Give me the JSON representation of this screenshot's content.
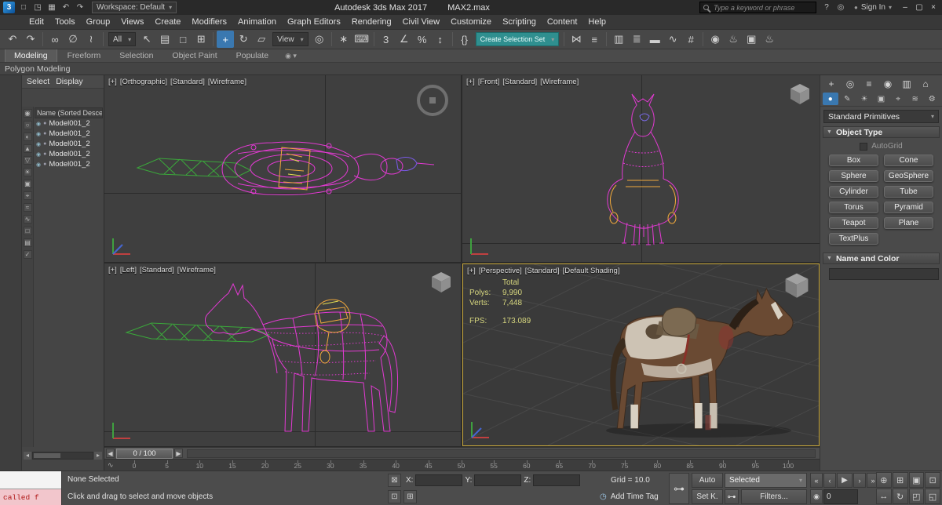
{
  "titlebar": {
    "logo_text": "3",
    "quick_icons": [
      {
        "name": "new-scene-icon",
        "glyph": "□"
      },
      {
        "name": "open-file-icon",
        "glyph": "◳"
      },
      {
        "name": "save-file-icon",
        "glyph": "▦"
      },
      {
        "name": "undo-quick-icon",
        "glyph": "↶"
      },
      {
        "name": "redo-quick-icon",
        "glyph": "↷"
      }
    ],
    "workspace_label": "Workspace: Default",
    "app_title": "Autodesk 3ds Max 2017",
    "file_name": "MAX2.max",
    "search_placeholder": "Type a keyword or phrase",
    "right_icons": [
      {
        "name": "help-icon",
        "glyph": "?"
      },
      {
        "name": "notifications-icon",
        "glyph": "◎"
      }
    ],
    "sign_in_label": "Sign In",
    "window_icons": [
      {
        "name": "minimize-icon",
        "glyph": "–"
      },
      {
        "name": "maximize-icon",
        "glyph": "▢"
      },
      {
        "name": "close-icon",
        "glyph": "×"
      }
    ]
  },
  "menubar": {
    "items": [
      "Edit",
      "Tools",
      "Group",
      "Views",
      "Create",
      "Modifiers",
      "Animation",
      "Graph Editors",
      "Rendering",
      "Civil View",
      "Customize",
      "Scripting",
      "Content",
      "Help"
    ]
  },
  "toolbar": {
    "items": [
      {
        "t": "icon",
        "name": "undo-icon",
        "glyph": "↶"
      },
      {
        "t": "icon",
        "name": "redo-icon",
        "glyph": "↷"
      },
      {
        "t": "sep"
      },
      {
        "t": "icon",
        "name": "select-and-link-icon",
        "glyph": "∞"
      },
      {
        "t": "icon",
        "name": "unlink-selection-icon",
        "glyph": "∅"
      },
      {
        "t": "icon",
        "name": "bind-to-spacewarp-icon",
        "glyph": "≀"
      },
      {
        "t": "sep"
      },
      {
        "t": "dd",
        "name": "selection-filter-dropdown",
        "label": "All"
      },
      {
        "t": "icon",
        "name": "select-object-icon",
        "glyph": "↖"
      },
      {
        "t": "icon",
        "name": "select-by-name-icon",
        "glyph": "▤"
      },
      {
        "t": "icon",
        "name": "selection-region-icon",
        "glyph": "□"
      },
      {
        "t": "icon",
        "name": "window-crossing-icon",
        "glyph": "⊞"
      },
      {
        "t": "sep"
      },
      {
        "t": "icon",
        "name": "select-and-move-icon",
        "glyph": "+",
        "active": true
      },
      {
        "t": "icon",
        "name": "select-and-rotate-icon",
        "glyph": "↻"
      },
      {
        "t": "icon",
        "name": "select-and-scale-icon",
        "glyph": "▱"
      },
      {
        "t": "dd",
        "name": "reference-coordinate-dropdown",
        "label": "View"
      },
      {
        "t": "icon",
        "name": "use-pivot-point-icon",
        "glyph": "◎"
      },
      {
        "t": "sep"
      },
      {
        "t": "icon",
        "name": "select-and-manipulate-icon",
        "glyph": "∗"
      },
      {
        "t": "icon",
        "name": "keyboard-override-icon",
        "glyph": "⌨"
      },
      {
        "t": "sep"
      },
      {
        "t": "icon",
        "name": "snaps-toggle-icon",
        "glyph": "3"
      },
      {
        "t": "icon",
        "name": "angle-snap-icon",
        "glyph": "∠"
      },
      {
        "t": "icon",
        "name": "percent-snap-icon",
        "glyph": "%"
      },
      {
        "t": "icon",
        "name": "spinner-snap-icon",
        "glyph": "↕"
      },
      {
        "t": "sep"
      },
      {
        "t": "icon",
        "name": "edit-named-sets-icon",
        "glyph": "{}"
      },
      {
        "t": "teal",
        "name": "create-selection-set-dropdown",
        "label": "Create Selection Set"
      },
      {
        "t": "sep"
      },
      {
        "t": "icon",
        "name": "mirror-icon",
        "glyph": "⋈"
      },
      {
        "t": "icon",
        "name": "align-icon",
        "glyph": "≡"
      },
      {
        "t": "sep"
      },
      {
        "t": "icon",
        "name": "toggle-scene-explorer-icon",
        "glyph": "▥"
      },
      {
        "t": "icon",
        "name": "toggle-layer-explorer-icon",
        "glyph": "≣"
      },
      {
        "t": "icon",
        "name": "toggle-ribbon-icon",
        "glyph": "▬"
      },
      {
        "t": "icon",
        "name": "curve-editor-icon",
        "glyph": "∿"
      },
      {
        "t": "icon",
        "name": "schematic-view-icon",
        "glyph": "#"
      },
      {
        "t": "sep"
      },
      {
        "t": "icon",
        "name": "material-editor-icon",
        "glyph": "◉"
      },
      {
        "t": "icon",
        "name": "render-setup-icon",
        "glyph": "♨"
      },
      {
        "t": "icon",
        "name": "rendered-frame-window-icon",
        "glyph": "▣"
      },
      {
        "t": "icon",
        "name": "render-production-icon",
        "glyph": "♨"
      }
    ]
  },
  "ribbon": {
    "tabs": [
      "Modeling",
      "Freeform",
      "Selection",
      "Object Paint",
      "Populate"
    ],
    "active_tab": "Modeling",
    "panel_label": "Polygon Modeling"
  },
  "scene_explorer": {
    "menus": [
      "Select",
      "Display"
    ],
    "column_header": "Name (Sorted Descend",
    "row_icons": [
      {
        "name": "visibility-icon",
        "glyph": "◉"
      },
      {
        "name": "node-type-icon",
        "glyph": "●"
      }
    ],
    "tool_icons": [
      {
        "name": "se-display-all-icon",
        "glyph": "◉"
      },
      {
        "name": "se-display-none-icon",
        "glyph": "○"
      },
      {
        "name": "se-display-inverted-icon",
        "glyph": "◐"
      },
      {
        "name": "se-display-geometry-icon",
        "glyph": "▲"
      },
      {
        "name": "se-display-shapes-icon",
        "glyph": "▽"
      },
      {
        "name": "se-display-lights-icon",
        "glyph": "☀"
      },
      {
        "name": "se-display-cameras-icon",
        "glyph": "▣"
      },
      {
        "name": "se-display-helpers-icon",
        "glyph": "⌖"
      },
      {
        "name": "se-display-spacewarps-icon",
        "glyph": "≈"
      },
      {
        "name": "se-display-bones-icon",
        "glyph": "∿"
      },
      {
        "name": "se-display-containers-icon",
        "glyph": "□"
      },
      {
        "name": "se-display-materials-icon",
        "glyph": "▤"
      },
      {
        "name": "se-pick-icon",
        "glyph": "✓"
      }
    ],
    "rows": [
      "Model001_2",
      "Model001_2",
      "Model001_2",
      "Model001_2",
      "Model001_2"
    ]
  },
  "viewports": {
    "ortho": {
      "plus": "[+]",
      "name": "[Orthographic]",
      "style": "[Standard]",
      "shading": "[Wireframe]"
    },
    "front": {
      "plus": "[+]",
      "name": "[Front]",
      "style": "[Standard]",
      "shading": "[Wireframe]"
    },
    "left": {
      "plus": "[+]",
      "name": "[Left]",
      "style": "[Standard]",
      "shading": "[Wireframe]"
    },
    "persp": {
      "plus": "[+]",
      "name": "[Perspective]",
      "style": "[Standard]",
      "shading": "[Default Shading]",
      "stats": {
        "total_label": "Total",
        "polys_label": "Polys:",
        "polys_value": "9,990",
        "verts_label": "Verts:",
        "verts_value": "7,448",
        "fps_label": "FPS:",
        "fps_value": "173.089"
      }
    }
  },
  "command_panel": {
    "tabs": [
      {
        "name": "create-tab-icon",
        "glyph": "+"
      },
      {
        "name": "modify-tab-icon",
        "glyph": "◎"
      },
      {
        "name": "hierarchy-tab-icon",
        "glyph": "≡"
      },
      {
        "name": "motion-tab-icon",
        "glyph": "◉"
      },
      {
        "name": "display-tab-icon",
        "glyph": "▥"
      },
      {
        "name": "utilities-tab-icon",
        "glyph": "⌂"
      }
    ],
    "subtabs": [
      {
        "name": "geometry-icon",
        "glyph": "●",
        "active": true
      },
      {
        "name": "shapes-icon",
        "glyph": "✎"
      },
      {
        "name": "lights-icon",
        "glyph": "☀"
      },
      {
        "name": "cameras-icon",
        "glyph": "▣"
      },
      {
        "name": "helpers-icon",
        "glyph": "⌖"
      },
      {
        "name": "space-warps-icon",
        "glyph": "≋"
      },
      {
        "name": "systems-icon",
        "glyph": "⚙"
      }
    ],
    "category_dropdown": "Standard Primitives",
    "object_type": {
      "title": "Object Type",
      "autogrid_label": "AutoGrid",
      "buttons": [
        "Box",
        "Cone",
        "Sphere",
        "GeoSphere",
        "Cylinder",
        "Tube",
        "Torus",
        "Pyramid",
        "Teapot",
        "Plane",
        "TextPlus"
      ]
    },
    "name_color": {
      "title": "Name and Color",
      "swatch_color": "#e8399e"
    }
  },
  "timeline": {
    "slider_value": "0 / 100",
    "ticks": [
      "0",
      "5",
      "10",
      "15",
      "20",
      "25",
      "30",
      "35",
      "40",
      "45",
      "50",
      "55",
      "60",
      "65",
      "70",
      "75",
      "80",
      "85",
      "90",
      "95",
      "100"
    ]
  },
  "statusbar": {
    "listener_text": "called f",
    "selection_status": "None Selected",
    "prompt": "Click and drag to select and move objects",
    "coord_labels": {
      "x": "X:",
      "y": "Y:",
      "z": "Z:"
    },
    "grid_label": "Grid = 10.0",
    "add_time_tag": "Add Time Tag",
    "auto_key_label": "Auto",
    "selected_label": "Selected",
    "set_key_label": "Set K.",
    "filters_label": "Filters...",
    "time_value": "0",
    "transport_icons": [
      {
        "name": "go-to-start-icon",
        "glyph": "«"
      },
      {
        "name": "previous-frame-icon",
        "glyph": "‹"
      },
      {
        "name": "play-icon",
        "glyph": "▶"
      },
      {
        "name": "next-frame-icon",
        "glyph": "›"
      },
      {
        "name": "go-to-end-icon",
        "glyph": "»"
      }
    ],
    "nav_icons": [
      {
        "name": "zoom-icon",
        "glyph": "⊕"
      },
      {
        "name": "zoom-all-icon",
        "glyph": "⊞"
      },
      {
        "name": "zoom-extents-icon",
        "glyph": "▣"
      },
      {
        "name": "zoom-extents-all-icon",
        "glyph": "⊡"
      },
      {
        "name": "pan-icon",
        "glyph": "↔"
      },
      {
        "name": "orbit-icon",
        "glyph": "↻"
      },
      {
        "name": "zoom-region-icon",
        "glyph": "◰"
      },
      {
        "name": "maximize-viewport-icon",
        "glyph": "◱"
      }
    ]
  },
  "colors": {
    "accent_teal": "#2f8f8f",
    "active_viewport_border": "#c9a93b",
    "wire_magenta": "#e23ad2",
    "lance_green": "#3ba83b",
    "saddle_orange": "#f0a83c",
    "stats_yellow": "#d6d67e",
    "selection_blue": "#3a78b0"
  }
}
